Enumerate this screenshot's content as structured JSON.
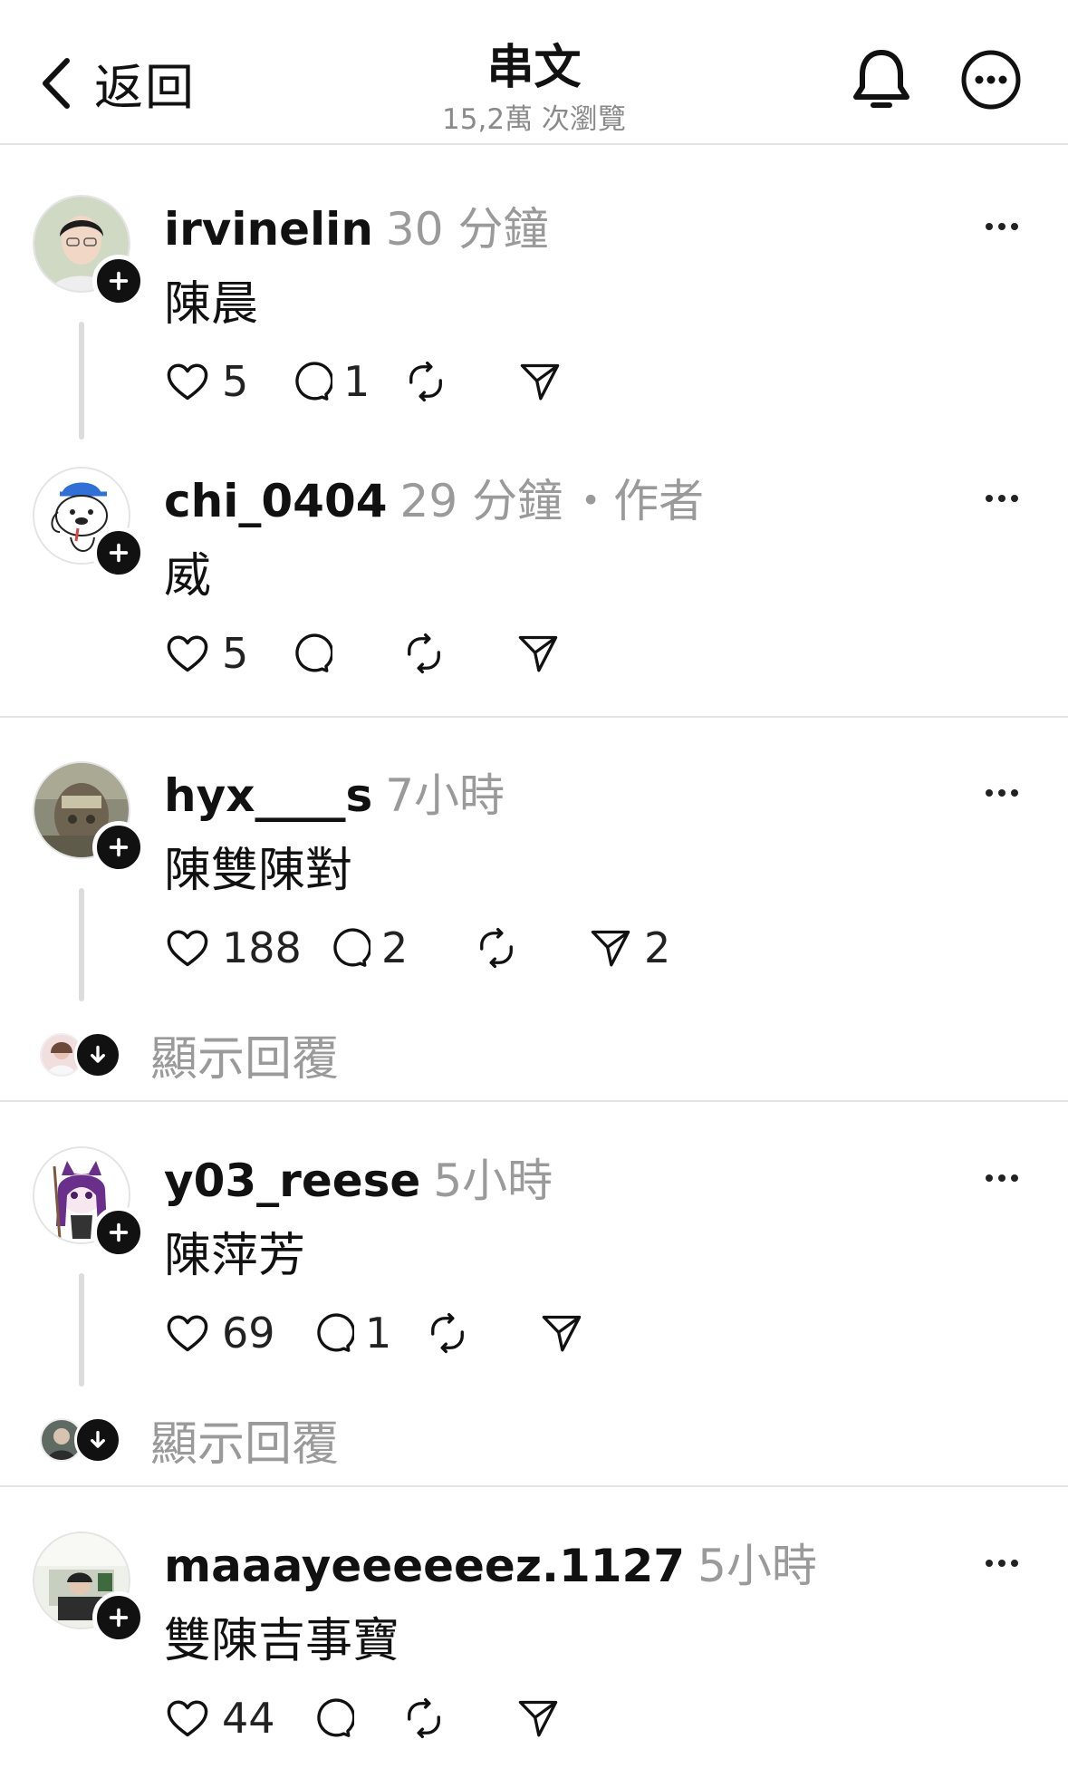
{
  "header": {
    "back_label": "返回",
    "title": "串文",
    "views": "15,2萬 次瀏覽"
  },
  "posts": [
    {
      "username": "irvinelin",
      "time": "30 分鐘",
      "tag": "",
      "text": "陳晨",
      "likes": "5",
      "replies": "1",
      "shares": ""
    },
    {
      "username": "chi_0404",
      "time": "29 分鐘",
      "tag": "・作者",
      "text": "威",
      "likes": "5",
      "replies": "",
      "shares": ""
    },
    {
      "username": "hyx____s",
      "time": "7小時",
      "tag": "",
      "text": "陳雙陳對",
      "likes": "188",
      "replies": "2",
      "shares": "2"
    },
    {
      "username": "y03_reese",
      "time": "5小時",
      "tag": "",
      "text": "陳萍芳",
      "likes": "69",
      "replies": "1",
      "shares": ""
    },
    {
      "username": "maaayeeeeeez.1127",
      "time": "5小時",
      "tag": "",
      "text": "雙陳吉事寶",
      "likes": "44",
      "replies": "",
      "shares": ""
    }
  ],
  "show_replies_label": "顯示回覆",
  "icons": [
    "chevron-left-icon",
    "bell-icon",
    "more-circle-icon",
    "plus-icon",
    "more-horizontal-icon",
    "heart-icon",
    "comment-icon",
    "repost-icon",
    "send-icon",
    "arrow-down-icon"
  ]
}
